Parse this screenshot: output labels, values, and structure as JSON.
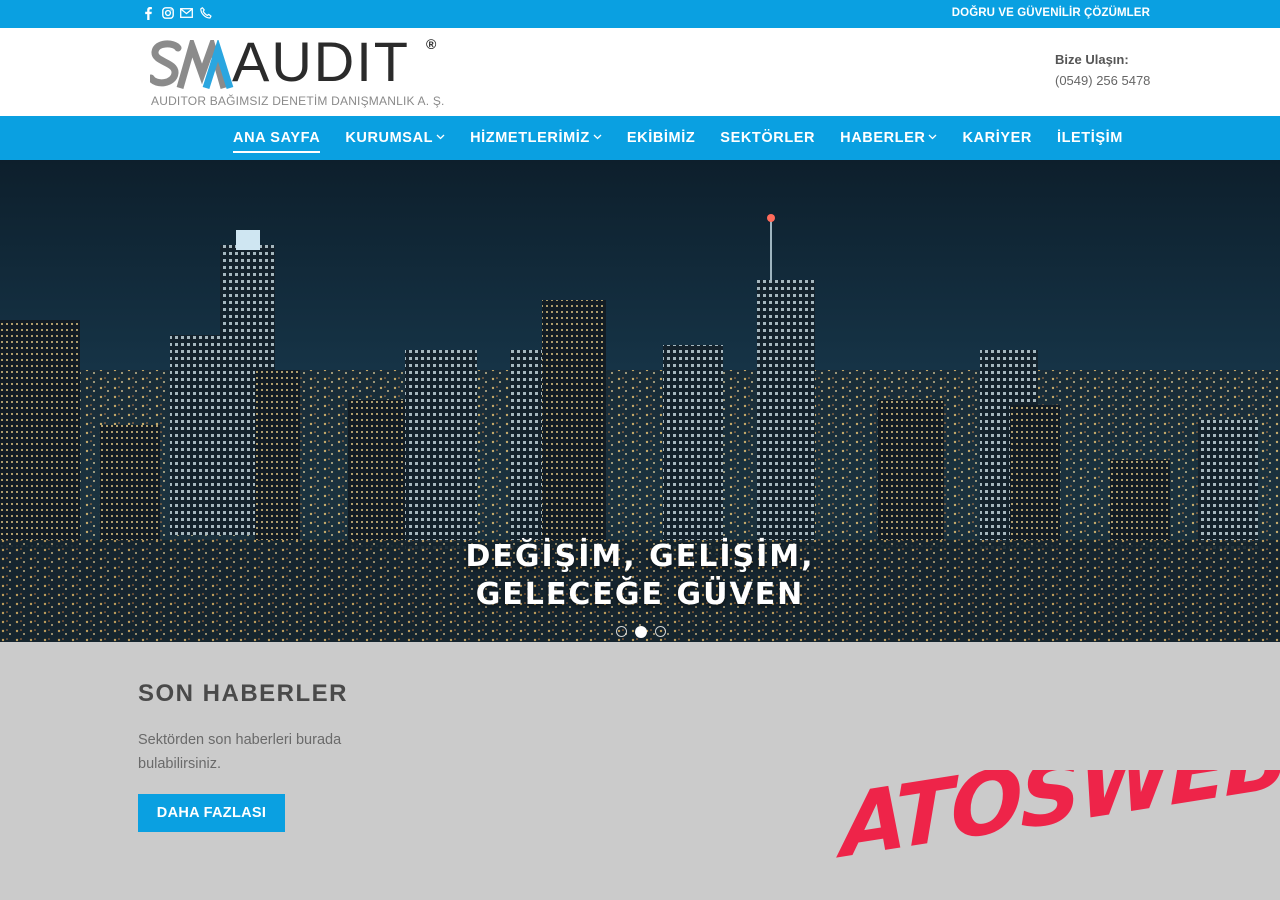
{
  "topbar": {
    "tagline": "DOĞRU VE GÜVENİLİR ÇÖZÜMLER",
    "social_icons": [
      "facebook-icon",
      "instagram-icon",
      "mail-icon",
      "phone-icon"
    ]
  },
  "header": {
    "logo_mark": "SM",
    "logo_word": "AUDIT",
    "logo_reg": "®",
    "logo_subtitle": "AUDITOR BAĞIMSIZ DENETİM DANIŞMANLIK A. Ş.",
    "contact_label": "Bize Ulaşın:",
    "contact_phone": "(0549) 256 5478"
  },
  "nav": {
    "items": [
      {
        "label": "ANA SAYFA",
        "active": true,
        "dropdown": false
      },
      {
        "label": "KURUMSAL",
        "active": false,
        "dropdown": true
      },
      {
        "label": "HİZMETLERİMİZ",
        "active": false,
        "dropdown": true
      },
      {
        "label": "EKİBİMİZ",
        "active": false,
        "dropdown": false
      },
      {
        "label": "SEKTÖRLER",
        "active": false,
        "dropdown": false
      },
      {
        "label": "HABERLER",
        "active": false,
        "dropdown": true
      },
      {
        "label": "KARİYER",
        "active": false,
        "dropdown": false
      },
      {
        "label": "İLETİŞİM",
        "active": false,
        "dropdown": false
      }
    ]
  },
  "hero": {
    "line1": "DEĞİŞİM, GELİŞİM,",
    "line2": "GELECEĞE GÜVEN",
    "slides_total": 3,
    "active_slide": 2
  },
  "news": {
    "title": "SON HABERLER",
    "description": "Sektörden son haberleri burada bulabilirsiniz.",
    "button_label": "DAHA FAZLASI"
  },
  "watermark": "ATOSWEB",
  "colors": {
    "primary": "#0aa0e1",
    "section_bg": "#cbcbcb",
    "watermark": "#ee2449"
  }
}
